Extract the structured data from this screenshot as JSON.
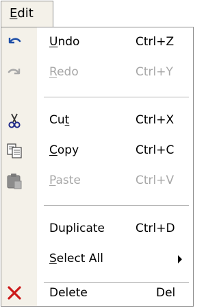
{
  "menubar": {
    "title_prefix": "E",
    "title_rest": "dit"
  },
  "items": [
    {
      "pre": "",
      "u": "U",
      "post": "ndo",
      "shortcut": "Ctrl+Z",
      "icon": "undo-icon",
      "enabled": true
    },
    {
      "pre": "",
      "u": "R",
      "post": "edo",
      "shortcut": "Ctrl+Y",
      "icon": "redo-icon",
      "enabled": false
    },
    {
      "pre": "Cu",
      "u": "t",
      "post": "",
      "shortcut": "Ctrl+X",
      "icon": "scissors-icon",
      "enabled": true
    },
    {
      "pre": "",
      "u": "C",
      "post": "opy",
      "shortcut": "Ctrl+C",
      "icon": "copy-icon",
      "enabled": true
    },
    {
      "pre": "",
      "u": "P",
      "post": "aste",
      "shortcut": "Ctrl+V",
      "icon": "paste-icon",
      "enabled": false
    },
    {
      "pre": "Duplicate",
      "u": "",
      "post": "",
      "shortcut": "Ctrl+D",
      "icon": "",
      "enabled": true
    },
    {
      "pre": "",
      "u": "S",
      "post": "elect All",
      "shortcut": "",
      "icon": "",
      "enabled": true,
      "submenu": true
    },
    {
      "pre": "Delete",
      "u": "",
      "post": "",
      "shortcut": "Del",
      "icon": "delete-icon",
      "enabled": true
    }
  ],
  "colors": {
    "gutter": "#f4f1e9",
    "border": "#8a8a8a",
    "disabled_text": "#a7a7a7",
    "delete_icon": "#cc1a1a",
    "undo_icon": "#1e4fa8"
  }
}
